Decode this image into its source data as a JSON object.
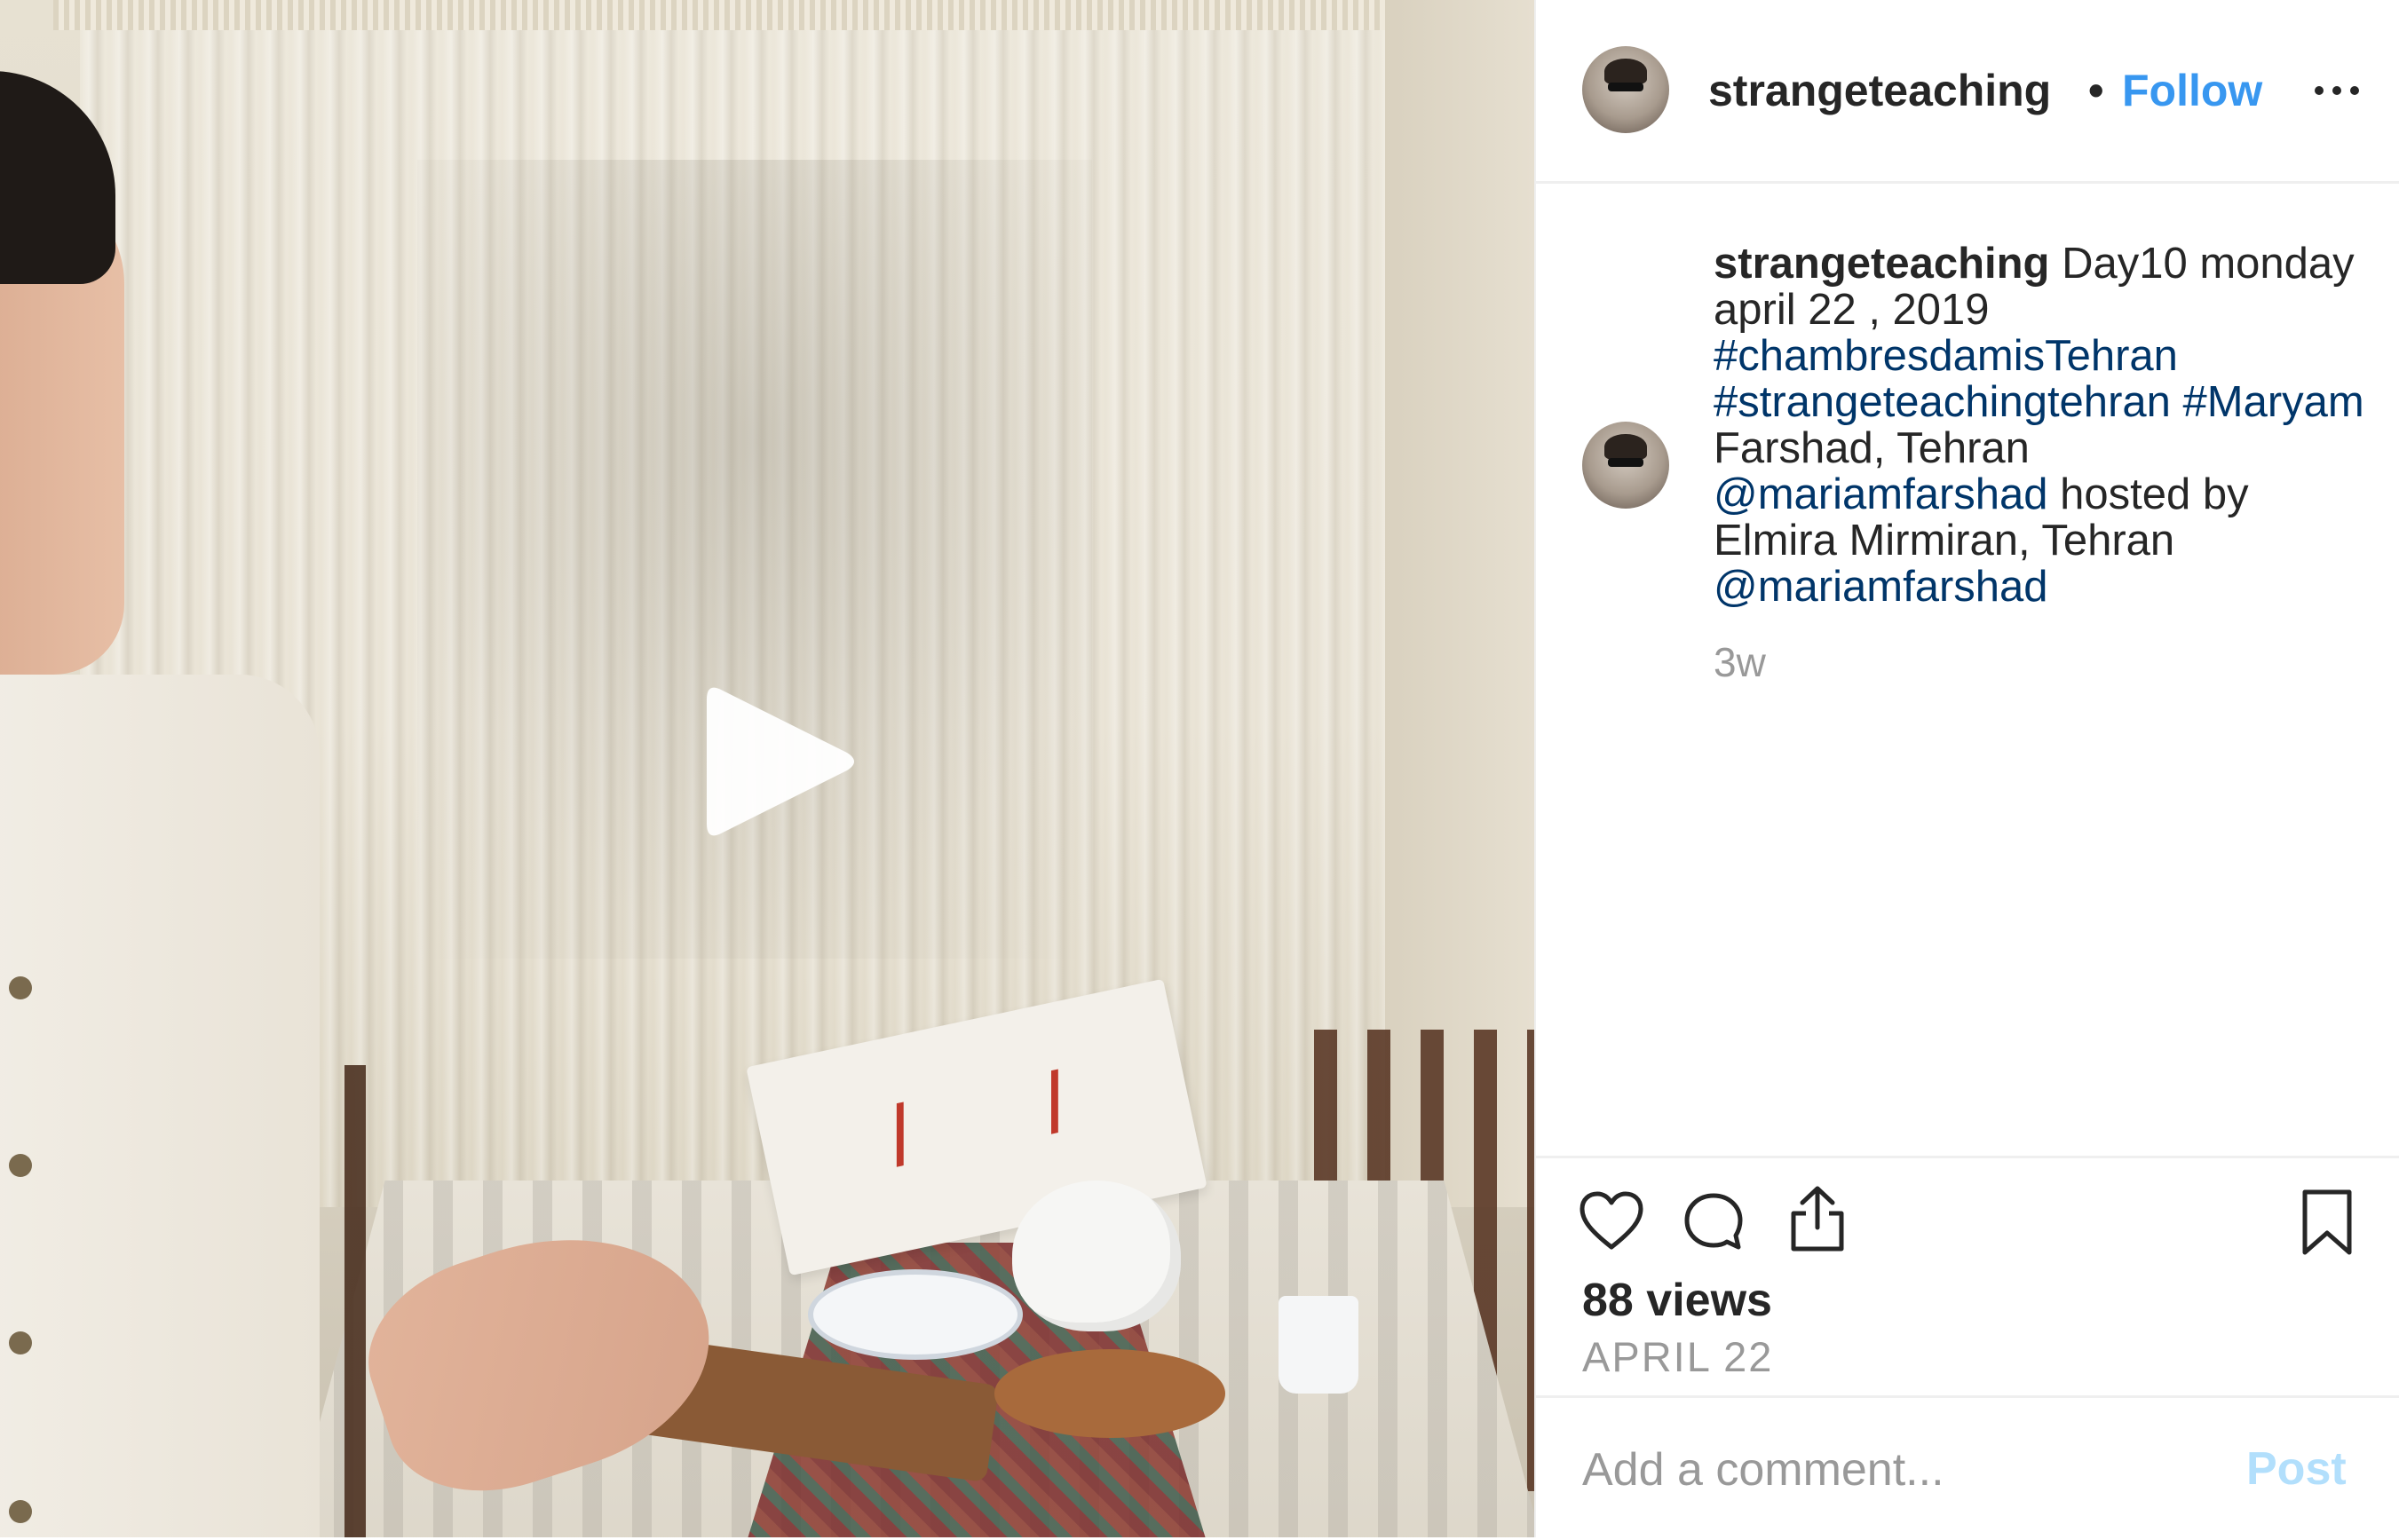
{
  "post": {
    "header": {
      "username": "strangeteaching",
      "separator": "•",
      "follow_label": "Follow",
      "more_icon": "more-horizontal-icon"
    },
    "caption": {
      "username": "strangeteaching",
      "lines": [
        {
          "type": "text",
          "value": " Day10 monday april 22 , 2019 "
        },
        {
          "type": "hashtag",
          "value": "#chambresdamisTehran"
        },
        {
          "type": "hashtag",
          "value": "#strangeteachingtehran"
        },
        {
          "type": "hashtag",
          "value": "#Maryam"
        },
        {
          "type": "text",
          "value": " Farshad, Tehran "
        },
        {
          "type": "mention",
          "value": "@mariamfarshad"
        },
        {
          "type": "text",
          "value": " hosted by Elmira Mirmiran, Tehran "
        },
        {
          "type": "mention",
          "value": "@mariamfarshad"
        }
      ],
      "timestamp": "3w"
    },
    "actions": {
      "icons": [
        "heart-icon",
        "comment-icon",
        "share-icon",
        "bookmark-icon"
      ],
      "views": "88 views",
      "date": "APRIL 22"
    },
    "comment": {
      "placeholder": "Add a comment...",
      "post_label": "Post"
    },
    "video": {
      "play_icon": "play-icon"
    }
  },
  "colors": {
    "link_blue": "#3897f0",
    "hashtag_blue": "#003569",
    "muted_gray": "#999999",
    "post_disabled": "#b2dffc",
    "divider": "#efefef"
  }
}
